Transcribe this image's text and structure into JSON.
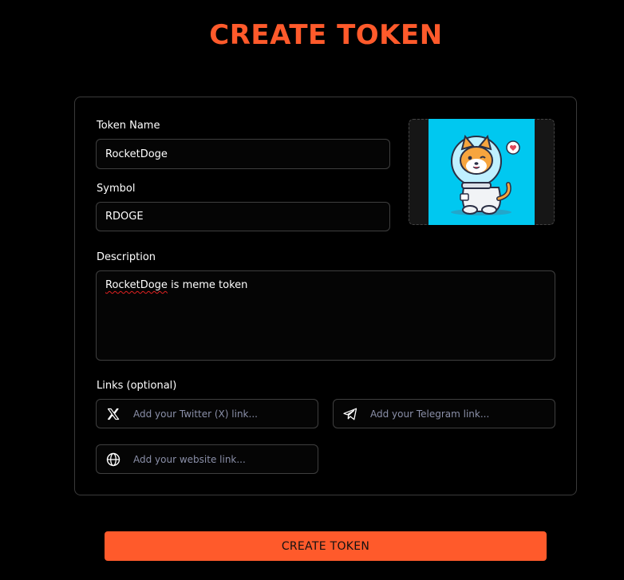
{
  "page_title": "CREATE TOKEN",
  "form": {
    "token_name": {
      "label": "Token Name",
      "value": "RocketDoge"
    },
    "symbol": {
      "label": "Symbol",
      "value": "RDOGE"
    },
    "description": {
      "label": "Description",
      "value_first_word": "RocketDoge",
      "value_rest": " is meme token"
    },
    "links": {
      "label": "Links (optional)",
      "twitter": {
        "placeholder": "Add your Twitter (X) link...",
        "icon": "x-twitter-icon"
      },
      "telegram": {
        "placeholder": "Add your Telegram link...",
        "icon": "telegram-icon"
      },
      "website": {
        "placeholder": "Add your website link...",
        "icon": "globe-icon"
      }
    },
    "image": {
      "icon": "token-image"
    }
  },
  "submit": {
    "label": "CREATE TOKEN"
  },
  "colors": {
    "accent": "#ff5a2b",
    "background": "#000000",
    "border": "#3f3f3f",
    "placeholder": "#8a8fa8",
    "image_bg": "#00c8f0"
  }
}
